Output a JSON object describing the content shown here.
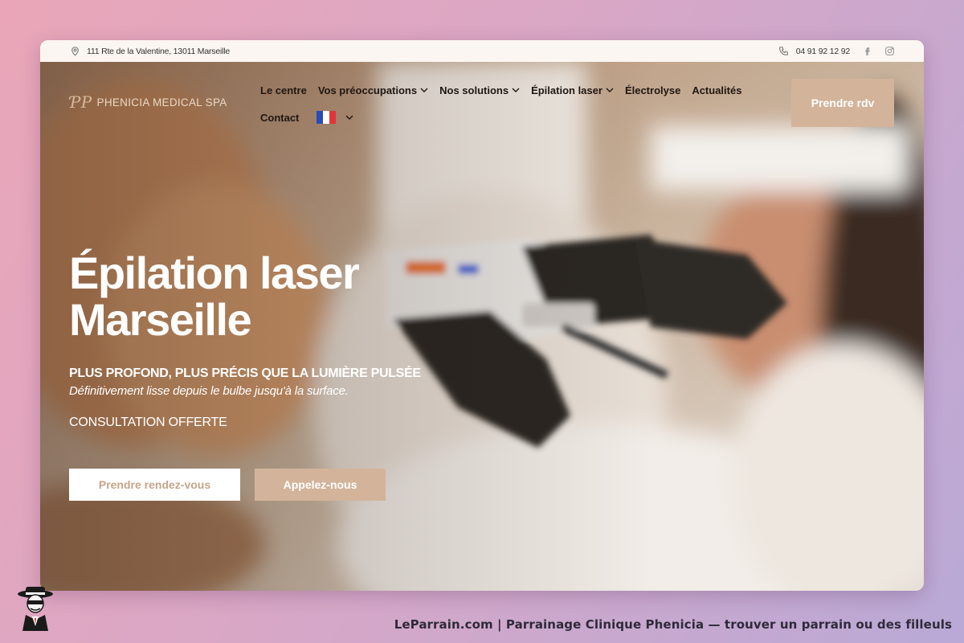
{
  "topbar": {
    "address": "111 Rte de la Valentine, 13011 Marseille",
    "phone": "04 91 92 12 92",
    "social": [
      "facebook-icon",
      "instagram-icon"
    ]
  },
  "header": {
    "logo_text": "PHENICIA MEDICAL SPA",
    "logo_mark": "ƤP",
    "nav": [
      {
        "label": "Le centre",
        "has_dropdown": false
      },
      {
        "label": "Vos préoccupations",
        "has_dropdown": true
      },
      {
        "label": "Nos solutions",
        "has_dropdown": true
      },
      {
        "label": "Épilation laser",
        "has_dropdown": true
      },
      {
        "label": "Électrolyse",
        "has_dropdown": false
      },
      {
        "label": "Actualités",
        "has_dropdown": false
      },
      {
        "label": "Contact",
        "has_dropdown": false
      }
    ],
    "language": "fr",
    "cta_label": "Prendre rdv"
  },
  "hero": {
    "title_line1": "Épilation laser",
    "title_line2": "Marseille",
    "subtitle": "PLUS PROFOND, PLUS PRÉCIS QUE LA LUMIÈRE PULSÉE",
    "tagline": "Définitivement lisse depuis le bulbe jusqu'à la surface.",
    "offer": "CONSULTATION OFFERTE",
    "primary_button": "Prendre rendez-vous",
    "secondary_button": "Appelez-nous"
  },
  "footer": {
    "caption": "LeParrain.com | Parrainage Clinique Phenicia — trouver un parrain ou des filleuls"
  },
  "colors": {
    "accent": "#d3b49a",
    "topbar_bg": "#fbf6f1",
    "nav_text": "#1f1712"
  }
}
